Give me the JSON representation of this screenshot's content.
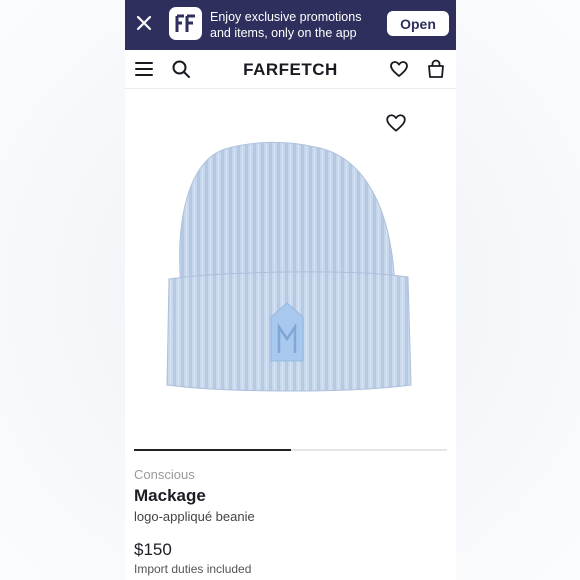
{
  "banner": {
    "promo_text": "Enjoy exclusive promotions and items, only on the app",
    "open_label": "Open"
  },
  "header": {
    "logo": "FARFETCH",
    "icons": [
      "menu-icon",
      "search-icon",
      "heart-icon",
      "bag-icon"
    ]
  },
  "gallery": {
    "progress": 0.5
  },
  "product": {
    "tag": "Conscious",
    "brand": "Mackage",
    "name": "logo-appliqué beanie",
    "price": "$150",
    "duties_note": "Import duties included"
  },
  "colors": {
    "banner_bg": "#2e2f5c",
    "beanie": "#c5d6ec"
  }
}
